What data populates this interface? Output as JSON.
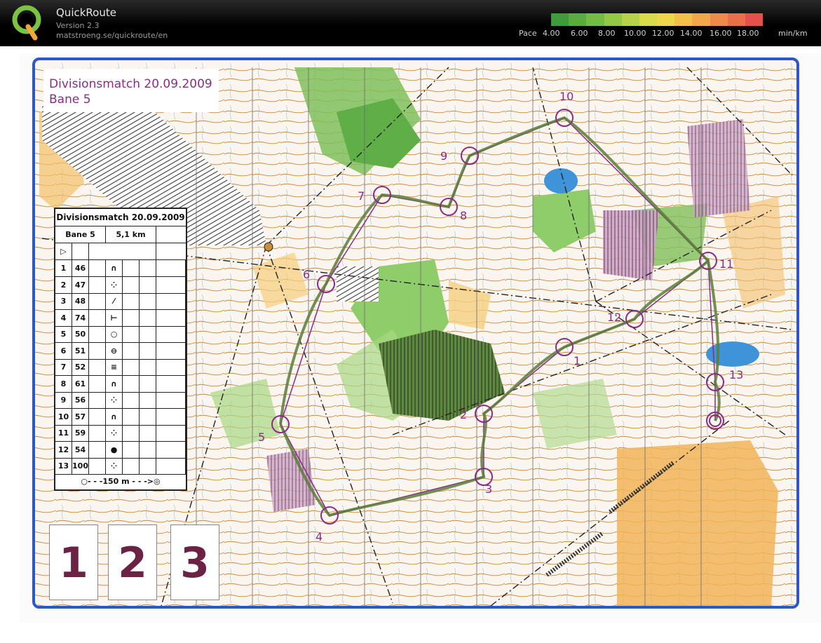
{
  "app": {
    "title": "QuickRoute",
    "version": "Version 2.3",
    "url": "matstroeng.se/quickroute/en"
  },
  "pace": {
    "label": "Pace",
    "unit": "min/km",
    "ticks": [
      "4.00",
      "6.00",
      "8.00",
      "10.00",
      "12.00",
      "14.00",
      "16.00",
      "18.00"
    ],
    "colors": [
      "#3e9d3a",
      "#58ad3e",
      "#74bd43",
      "#93c945",
      "#b7d448",
      "#d9db4a",
      "#f0d64a",
      "#f4c04a",
      "#f3a64a",
      "#ef8a4a",
      "#eb6e4a",
      "#e5504a"
    ]
  },
  "map": {
    "title": "Divisionsmatch 20.09.2009",
    "subtitle": "Bane 5",
    "description": {
      "title": "Divisionsmatch 20.09.2009",
      "course": "Bane 5",
      "length": "5,1 km",
      "start_symbol": "▷",
      "rows": [
        {
          "n": "1",
          "code": "46",
          "sym": "∩"
        },
        {
          "n": "2",
          "code": "47",
          "sym": "⁘"
        },
        {
          "n": "3",
          "code": "48",
          "sym": "⁄"
        },
        {
          "n": "4",
          "code": "74",
          "sym": "⊢"
        },
        {
          "n": "5",
          "code": "50",
          "sym": "○"
        },
        {
          "n": "6",
          "code": "51",
          "sym": "⊖"
        },
        {
          "n": "7",
          "code": "52",
          "sym": "≡"
        },
        {
          "n": "8",
          "code": "61",
          "sym": "∩"
        },
        {
          "n": "9",
          "code": "56",
          "sym": "⁘"
        },
        {
          "n": "10",
          "code": "57",
          "sym": "∩"
        },
        {
          "n": "11",
          "code": "59",
          "sym": "⁘"
        },
        {
          "n": "12",
          "code": "54",
          "sym": "●"
        },
        {
          "n": "13",
          "code": "100",
          "sym": "⁘"
        }
      ],
      "footer": "○- - -150 m - - ->◎"
    },
    "places": [
      "1",
      "2",
      "3"
    ],
    "controls": [
      {
        "label": "1"
      },
      {
        "label": "2"
      },
      {
        "label": "3"
      },
      {
        "label": "4"
      },
      {
        "label": "5"
      },
      {
        "label": "6"
      },
      {
        "label": "7"
      },
      {
        "label": "8"
      },
      {
        "label": "9"
      },
      {
        "label": "10"
      },
      {
        "label": "11"
      },
      {
        "label": "12"
      },
      {
        "label": "13"
      }
    ]
  }
}
